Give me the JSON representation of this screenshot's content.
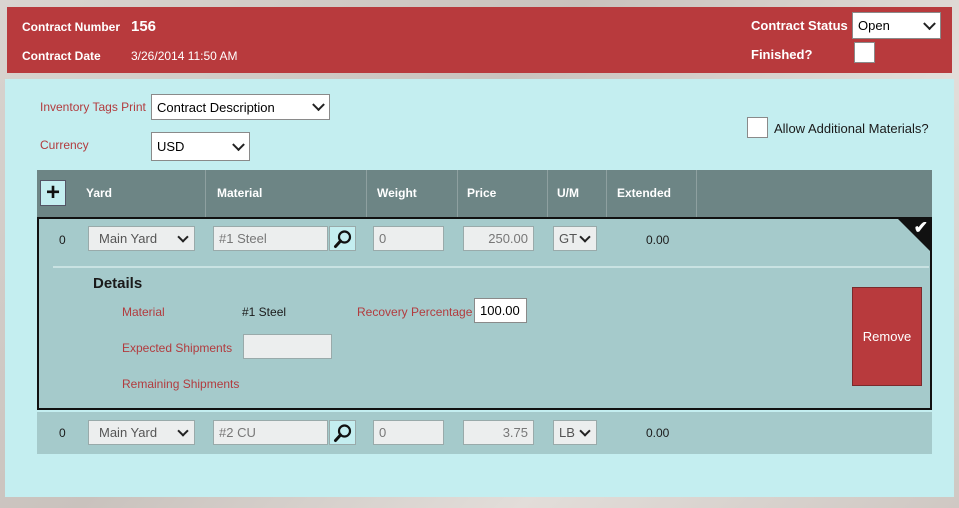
{
  "header": {
    "contract_number_label": "Contract Number",
    "contract_number": "156",
    "contract_date_label": "Contract Date",
    "contract_date": "3/26/2014 11:50 AM",
    "contract_status_label": "Contract Status",
    "contract_status": "Open",
    "finished_label": "Finished?"
  },
  "form": {
    "inventory_tags_label": "Inventory Tags Print",
    "inventory_tags_value": "Contract Description",
    "currency_label": "Currency",
    "currency_value": "USD",
    "allow_additional_label": "Allow Additional Materials?"
  },
  "grid": {
    "add_symbol": "+",
    "columns": [
      "Yard",
      "Material",
      "Weight",
      "Price",
      "U/M",
      "Extended"
    ],
    "rows": [
      {
        "index": "0",
        "yard": "Main Yard",
        "material": "#1 Steel",
        "weight": "0",
        "price": "250.00",
        "um": "GT",
        "extended": "0.00"
      },
      {
        "index": "0",
        "yard": "Main Yard",
        "material": "#2 CU",
        "weight": "0",
        "price": "3.75",
        "um": "LB",
        "extended": "0.00"
      }
    ]
  },
  "details": {
    "title": "Details",
    "material_label": "Material",
    "material_value": "#1 Steel",
    "recovery_label": "Recovery Percentage",
    "recovery_value": "100.00",
    "expected_label": "Expected Shipments",
    "expected_value": "",
    "remaining_label": "Remaining Shipments",
    "remove_label": "Remove",
    "selected_check": "✔"
  },
  "colors": {
    "header_bg": "#b83a3d",
    "panel_bg": "#c4eef0",
    "grid_header_bg": "#6d8585",
    "row_bg": "#a5cacb",
    "label_red": "#b23b3e"
  }
}
